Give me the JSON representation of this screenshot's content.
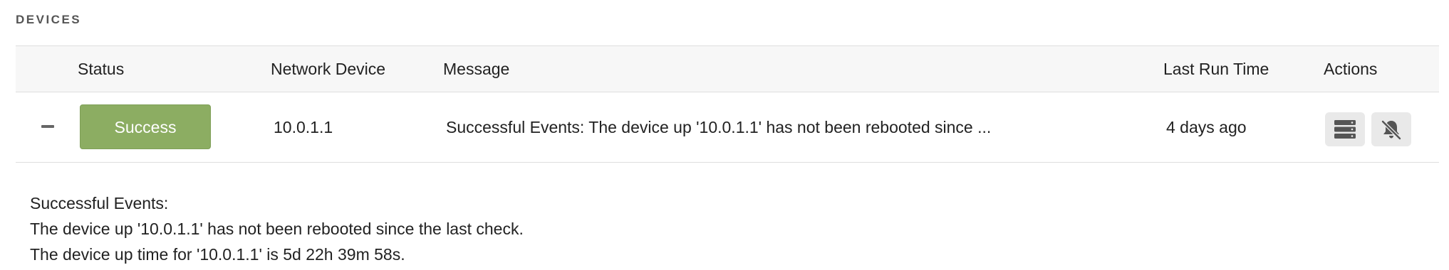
{
  "section": {
    "title": "DEVICES"
  },
  "table": {
    "headers": {
      "status": "Status",
      "network_device": "Network Device",
      "message": "Message",
      "last_run_time": "Last Run Time",
      "actions": "Actions"
    },
    "rows": [
      {
        "status": "Success",
        "network_device": "10.0.1.1",
        "message": "Successful Events: The device up '10.0.1.1' has not been rebooted since ...",
        "last_run_time": "4 days ago",
        "actions": {
          "details_icon": "server-list-icon",
          "mute_icon": "bell-slash-icon"
        }
      }
    ]
  },
  "details": {
    "lines": [
      "Successful Events:",
      "The device up '10.0.1.1' has not been rebooted since the last check.",
      "The device up time for '10.0.1.1' is 5d 22h 39m 58s."
    ]
  },
  "colors": {
    "success": "#8cad62",
    "header_bg": "#f7f7f7",
    "action_bg": "#e9e9e9"
  }
}
